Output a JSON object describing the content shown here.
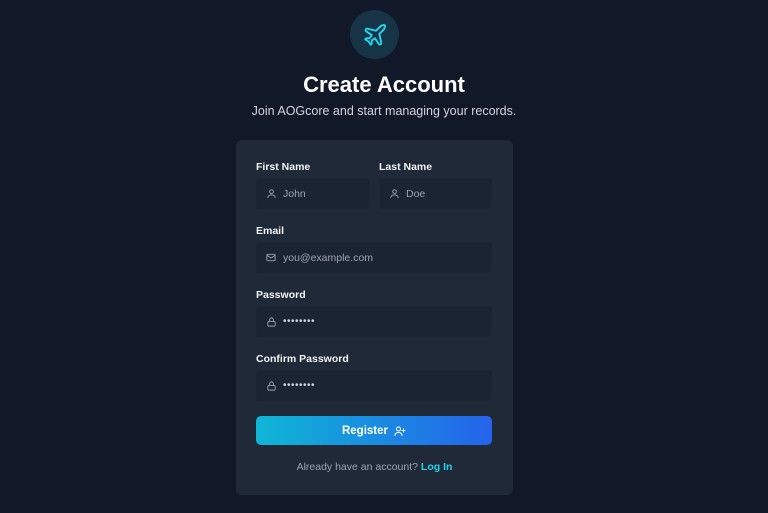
{
  "header": {
    "title": "Create Account",
    "subtitle": "Join AOGcore and start managing your records."
  },
  "form": {
    "first_name": {
      "label": "First Name",
      "placeholder": "John",
      "icon": "user-icon"
    },
    "last_name": {
      "label": "Last Name",
      "placeholder": "Doe",
      "icon": "user-icon"
    },
    "email": {
      "label": "Email",
      "placeholder": "you@example.com",
      "icon": "mail-icon"
    },
    "password": {
      "label": "Password",
      "value": "••••••••",
      "icon": "lock-icon"
    },
    "confirm_password": {
      "label": "Confirm Password",
      "value": "••••••••",
      "icon": "lock-icon"
    },
    "register_label": "Register",
    "register_icon": "user-plus-icon"
  },
  "footer": {
    "prompt": "Already have an account?",
    "login_label": "Log In"
  },
  "colors": {
    "background": "#111827",
    "card": "#1f2937",
    "accent_start": "#0fb6d6",
    "accent_end": "#2563eb",
    "link": "#22d3ee"
  }
}
